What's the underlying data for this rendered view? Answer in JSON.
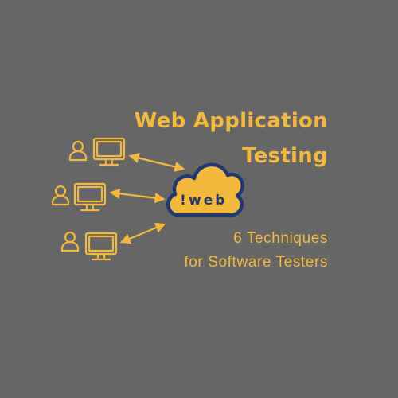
{
  "title": {
    "line1": "Web Application",
    "line2": "Testing"
  },
  "subtitle": {
    "line1": "6 Techniques",
    "line2": "for Software Testers"
  },
  "cloud": {
    "label": "web",
    "mark": "!"
  },
  "colors": {
    "background": "#666666",
    "accent": "#F4B83A",
    "cloud_fill": "#F4B83A",
    "cloud_outline": "#1F3A73"
  },
  "icons": {
    "user": "user-icon",
    "monitor": "monitor-icon",
    "arrow": "double-arrow-icon",
    "cloud": "cloud-icon"
  }
}
